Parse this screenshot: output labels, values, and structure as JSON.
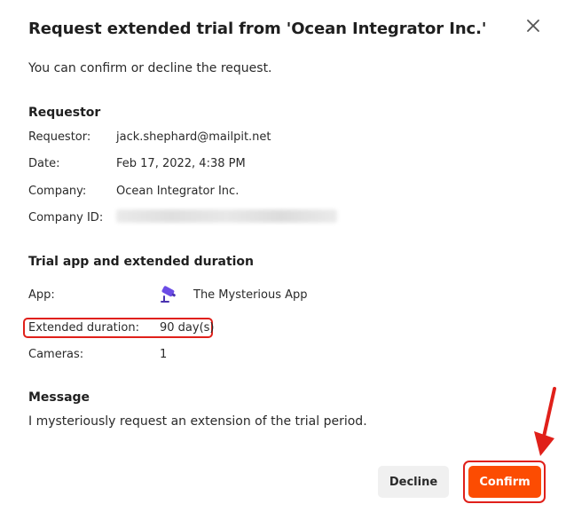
{
  "dialog": {
    "title": "Request extended trial from 'Ocean Integrator Inc.'",
    "intro": "You can confirm or decline the request."
  },
  "requestor_section": {
    "heading": "Requestor",
    "rows": [
      {
        "label": "Requestor:",
        "value": "jack.shephard@mailpit.net"
      },
      {
        "label": "Date:",
        "value": "Feb 17, 2022, 4:38 PM"
      },
      {
        "label": "Company:",
        "value": "Ocean Integrator Inc."
      },
      {
        "label": "Company ID:",
        "value": ""
      }
    ]
  },
  "trial_section": {
    "heading": "Trial app and extended duration",
    "app_label": "App:",
    "app_name": "The Mysterious App",
    "duration_label": "Extended duration:",
    "duration_value": "90 day(s)",
    "cameras_label": "Cameras:",
    "cameras_value": "1"
  },
  "message_section": {
    "heading": "Message",
    "text": "I mysteriously request an extension of the trial period."
  },
  "actions": {
    "decline_label": "Decline",
    "confirm_label": "Confirm"
  },
  "icons": {
    "close": "close-icon",
    "app": "camera-app-icon",
    "annotation_arrow": "arrow-icon"
  },
  "colors": {
    "accent": "#fc4c02",
    "annotation": "#e0201a",
    "secondary_button": "#f0f0f0"
  }
}
